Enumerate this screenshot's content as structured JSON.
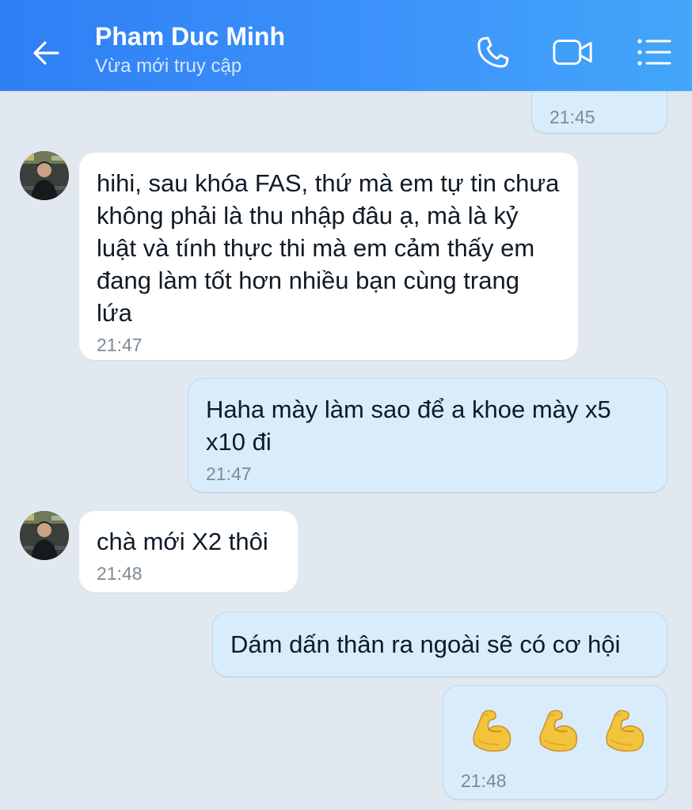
{
  "header": {
    "contact_name": "Pham Duc Minh",
    "status": "Vừa mới truy cập",
    "background_color": "#3489f7",
    "icons": [
      "back-arrow-icon",
      "phone-call-icon",
      "video-call-icon",
      "menu-list-icon"
    ]
  },
  "messages": [
    {
      "direction": "outgoing",
      "text": "",
      "time": "21:45"
    },
    {
      "direction": "incoming",
      "text": "hihi, sau khóa FAS, thứ mà em tự tin chưa không phải là thu nhập đâu ạ, mà là kỷ luật và tính thực thi mà em cảm thấy em đang làm tốt hơn nhiều bạn cùng trang lứa",
      "time": "21:47"
    },
    {
      "direction": "outgoing",
      "text": "Haha mày làm sao để a khoe mày x5 x10 đi",
      "time": "21:47"
    },
    {
      "direction": "incoming",
      "text": "chà mới X2 thôi",
      "time": "21:48"
    },
    {
      "direction": "outgoing",
      "text": "Dám dấn thân ra ngoài sẽ có cơ hội",
      "time": ""
    },
    {
      "direction": "outgoing",
      "emoji": [
        "flexed-biceps-emoji",
        "flexed-biceps-emoji",
        "flexed-biceps-emoji"
      ],
      "time": "21:48"
    }
  ],
  "colors": {
    "chat_background": "#e2e8f0",
    "incoming_bubble": "#ffffff",
    "outgoing_bubble": "#d8ecfb",
    "time_text": "#7e8a93"
  }
}
